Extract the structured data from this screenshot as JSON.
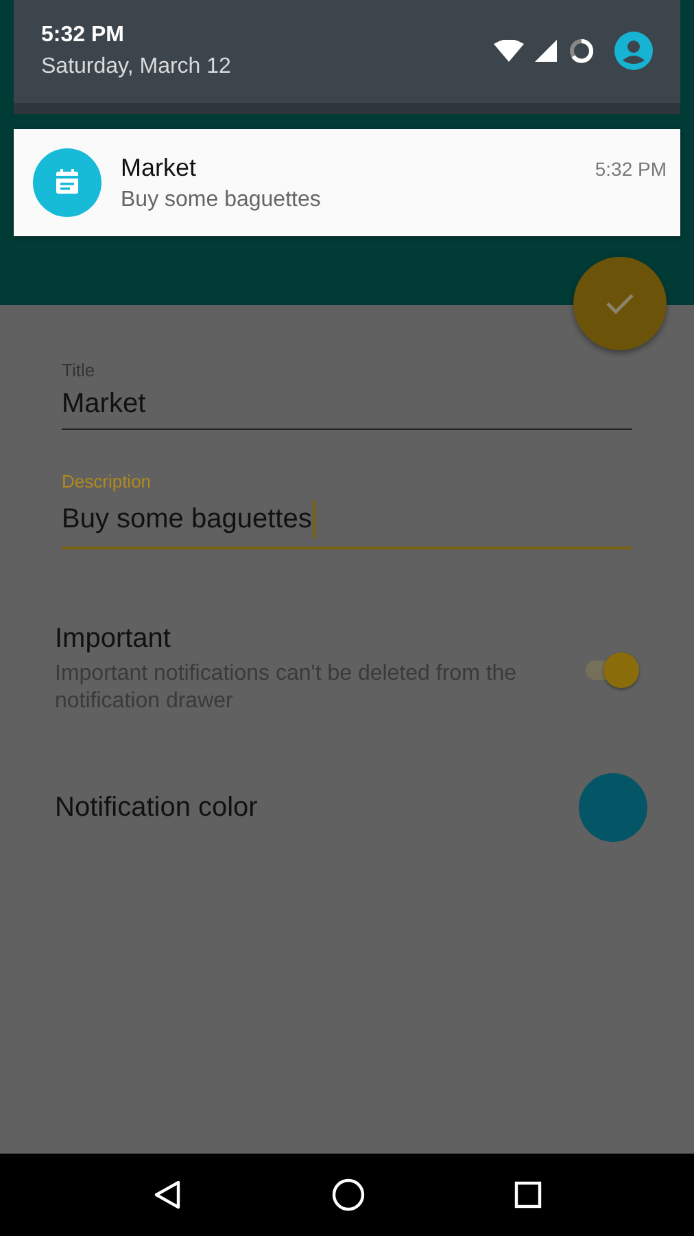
{
  "status_shade": {
    "time": "5:32 PM",
    "date": "Saturday, March 12"
  },
  "notification": {
    "title": "Market",
    "text": "Buy some baguettes",
    "time": "5:32 PM"
  },
  "fields": [
    {
      "label": "Title",
      "value": "Market",
      "focused": false
    },
    {
      "label": "Description",
      "value": "Buy some baguettes",
      "focused": true
    }
  ],
  "settings": [
    {
      "kind": "switch",
      "label": "Important",
      "description": "Important notifications can't be deleted from the notification drawer",
      "on": true
    },
    {
      "kind": "color",
      "label": "Notification color",
      "color": "#045565"
    }
  ]
}
